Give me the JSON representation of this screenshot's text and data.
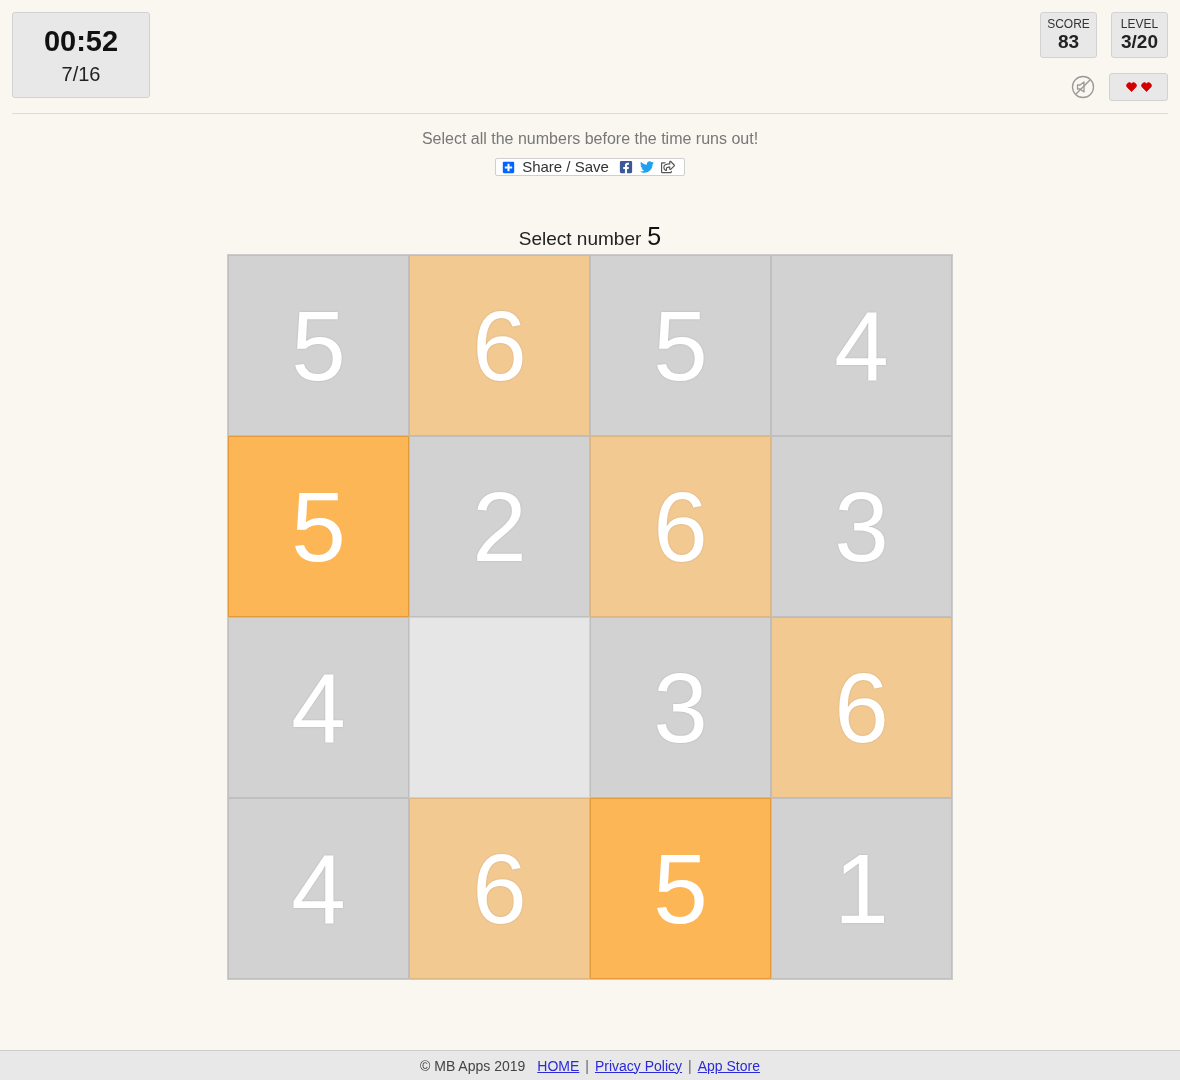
{
  "timer": {
    "time": "00:52",
    "progress": "7/16"
  },
  "stats": [
    {
      "label": "SCORE",
      "value": "83"
    },
    {
      "label": "LEVEL",
      "value": "3/20"
    }
  ],
  "sound": {
    "muted": true
  },
  "lives": [
    {
      "filled": true
    },
    {
      "filled": true
    }
  ],
  "instruction": "Select all the numbers before the time runs out!",
  "share": {
    "label": "Share / Save"
  },
  "prompt": {
    "text": "Select number",
    "target": "5"
  },
  "grid": {
    "tiles": [
      {
        "number": "5",
        "color": "#d2d2d2",
        "selected": false
      },
      {
        "number": "6",
        "color": "#f2c991",
        "selected": false
      },
      {
        "number": "5",
        "color": "#d2d2d2",
        "selected": false
      },
      {
        "number": "4",
        "color": "#d2d2d2",
        "selected": false
      },
      {
        "number": "5",
        "color": "#fcb655",
        "selected": true
      },
      {
        "number": "2",
        "color": "#d2d2d2",
        "selected": false
      },
      {
        "number": "6",
        "color": "#f2c991",
        "selected": false
      },
      {
        "number": "3",
        "color": "#d2d2d2",
        "selected": false
      },
      {
        "number": "4",
        "color": "#d2d2d2",
        "selected": false
      },
      {
        "color": "#e6e6e6",
        "selected": false
      },
      {
        "number": "3",
        "color": "#d2d2d2",
        "selected": false
      },
      {
        "number": "6",
        "color": "#f2c991",
        "selected": false
      },
      {
        "number": "4",
        "color": "#d2d2d2",
        "selected": false
      },
      {
        "number": "6",
        "color": "#f2c991",
        "selected": false
      },
      {
        "number": "5",
        "color": "#fcb655",
        "selected": true
      },
      {
        "number": "1",
        "color": "#d2d2d2",
        "selected": false
      }
    ]
  },
  "footer": {
    "copyright": "© MB Apps 2019",
    "links": [
      {
        "label": "HOME"
      },
      {
        "label": "Privacy Policy"
      },
      {
        "label": "App Store"
      }
    ],
    "separators": [
      "|",
      "|"
    ]
  }
}
